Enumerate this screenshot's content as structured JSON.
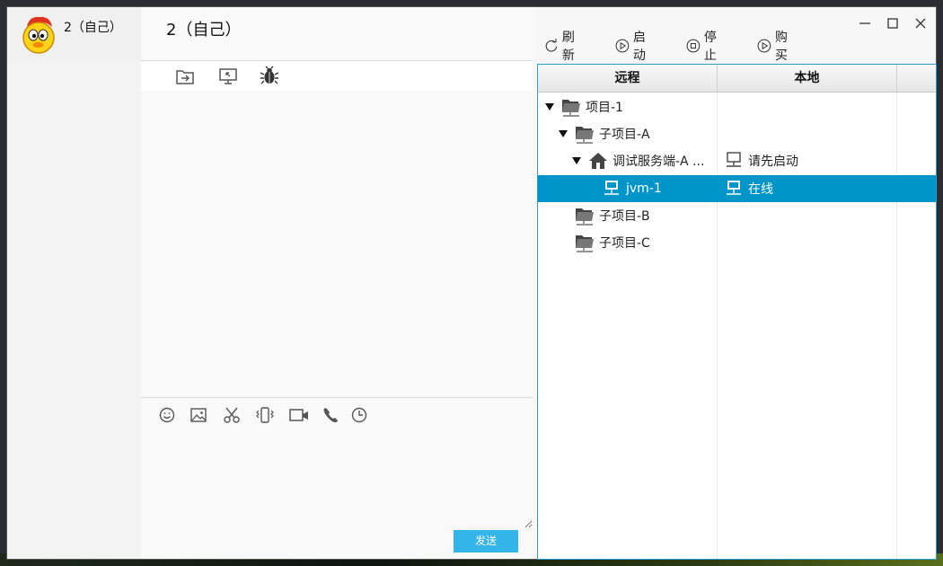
{
  "contacts": [
    {
      "name": "2（自己）"
    }
  ],
  "chat": {
    "title": "2（自己）",
    "toolbar_icons": [
      "folder-transfer-icon",
      "remote-desktop-icon",
      "bug-icon"
    ],
    "input_icons": [
      "emoji-icon",
      "image-icon",
      "scissors-icon",
      "vibrate-icon",
      "video-call-icon",
      "phone-icon",
      "history-icon"
    ],
    "send_label": "发送"
  },
  "window_controls": [
    "minimize",
    "maximize",
    "close"
  ],
  "actions": [
    {
      "icon": "refresh-icon",
      "label": "刷新"
    },
    {
      "icon": "play-icon",
      "label": "启动"
    },
    {
      "icon": "stop-icon",
      "label": "停止"
    },
    {
      "icon": "play-icon",
      "label": "购买"
    }
  ],
  "tree": {
    "columns": [
      "远程",
      "本地"
    ],
    "rows": [
      {
        "label": "项目-1",
        "icon": "network-folder-icon",
        "expanded": true,
        "local": "",
        "local_icon": ""
      },
      {
        "label": "子项目-A",
        "icon": "network-folder-icon",
        "expanded": true,
        "local": "",
        "local_icon": ""
      },
      {
        "label": "调试服务端-A ...",
        "icon": "home-icon",
        "expanded": true,
        "local": "请先启动",
        "local_icon": "computer-icon"
      },
      {
        "label": "jvm-1",
        "icon": "computer-icon",
        "expanded": false,
        "selected": true,
        "local": "在线",
        "local_icon": "computer-icon"
      },
      {
        "label": "子项目-B",
        "icon": "network-folder-icon",
        "expanded": false,
        "local": "",
        "local_icon": ""
      },
      {
        "label": "子项目-C",
        "icon": "network-folder-icon",
        "expanded": false,
        "local": "",
        "local_icon": ""
      }
    ]
  },
  "colors": {
    "accent": "#33b5ea",
    "selection": "#0095c8",
    "panel_border": "#2c9fd0"
  }
}
